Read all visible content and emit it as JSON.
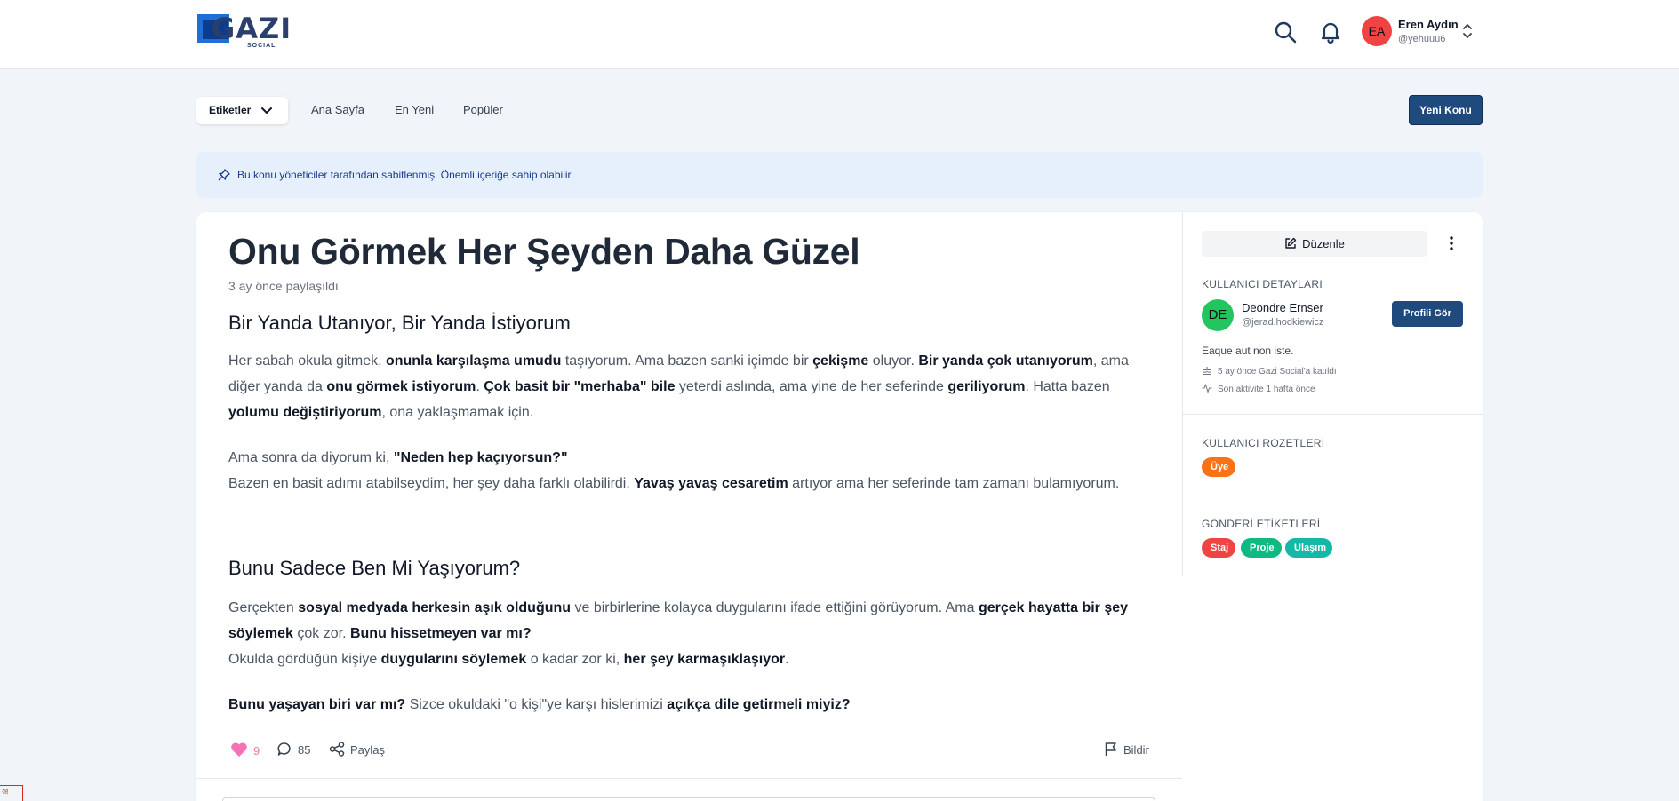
{
  "brand": {
    "logo_text": "GAZI",
    "logo_sub": "SOCIAL"
  },
  "header": {
    "icons": [
      "search-icon",
      "bell-icon"
    ],
    "user": {
      "initials": "EA",
      "name": "Eren Aydın",
      "handle": "@yehuuu6"
    }
  },
  "nav": {
    "tags_label": "Etiketler",
    "links": [
      "Ana Sayfa",
      "En Yeni",
      "Popüler"
    ],
    "new_topic": "Yeni Konu"
  },
  "pinned_notice": "Bu konu yöneticiler tarafından sabitlenmiş. Önemli içeriğe sahip olabilir.",
  "post": {
    "title": "Onu Görmek Her Şeyden Daha Güzel",
    "date": "3 ay önce paylaşıldı",
    "heading1": "Bir Yanda Utanıyor, Bir Yanda İstiyorum",
    "heading2": "Bunu Sadece Ben Mi Yaşıyorum?",
    "paragraphs": [
      [
        {
          "t": "Her sabah okula gitmek, "
        },
        {
          "t": "onunla karşılaşma umudu",
          "b": true
        },
        {
          "t": " taşıyorum. Ama bazen sanki içimde bir "
        },
        {
          "t": "çekişme",
          "b": true
        },
        {
          "t": " oluyor. "
        },
        {
          "t": "Bir yanda çok utanıyorum",
          "b": true
        },
        {
          "t": ", ama diğer yanda da "
        },
        {
          "t": "onu görmek istiyorum",
          "b": true
        },
        {
          "t": ". "
        },
        {
          "t": "Çok basit bir \"merhaba\" bile",
          "b": true
        },
        {
          "t": " yeterdi aslında, ama yine de her seferinde "
        },
        {
          "t": "geriliyorum",
          "b": true
        },
        {
          "t": ". Hatta bazen "
        },
        {
          "t": "yolumu değiştiriyorum",
          "b": true
        },
        {
          "t": ", ona yaklaşmamak için."
        }
      ],
      [
        {
          "t": "Ama sonra da diyorum ki, "
        },
        {
          "t": "\"Neden hep kaçıyorsun?\"",
          "b": true
        },
        {
          "br": true
        },
        {
          "t": "Bazen en basit adımı atabilseydim, her şey daha farklı olabilirdi. "
        },
        {
          "t": "Yavaş yavaş cesaretim",
          "b": true
        },
        {
          "t": " artıyor ama her seferinde tam zamanı bulamıyorum."
        }
      ],
      [
        {
          "t": "Gerçekten "
        },
        {
          "t": "sosyal medyada herkesin aşık olduğunu",
          "b": true
        },
        {
          "t": " ve birbirlerine kolayca duygularını ifade ettiğini görüyorum. Ama "
        },
        {
          "t": "gerçek hayatta bir şey söylemek",
          "b": true
        },
        {
          "t": " çok zor. "
        },
        {
          "t": "Bunu hissetmeyen var mı?",
          "b": true
        },
        {
          "br": true
        },
        {
          "t": "Okulda gördüğün kişiye "
        },
        {
          "t": "duygularını söylemek",
          "b": true
        },
        {
          "t": " o kadar zor ki, "
        },
        {
          "t": "her şey karmaşıklaşıyor",
          "b": true
        },
        {
          "t": "."
        }
      ],
      [
        {
          "t": "Bunu yaşayan biri var mı?",
          "b": true
        },
        {
          "t": " Sizce okuldaki \"o kişi\"ye karşı hislerimizi "
        },
        {
          "t": "açıkça dile getirmeli miyiz?",
          "b": true
        }
      ]
    ],
    "likes": "9",
    "comments": "85",
    "share_label": "Paylaş",
    "report_label": "Bildir"
  },
  "sidebar": {
    "edit_label": "Düzenle",
    "user_details_label": "KULLANICI DETAYLARI",
    "author": {
      "initials": "DE",
      "name": "Deondre Ernser",
      "handle": "@jerad.hodkiewicz"
    },
    "profile_button": "Profili Gör",
    "bio": "Eaque aut non iste.",
    "joined": "5 ay önce Gazi Social'a katıldı",
    "last_active": "Son aktivite 1 hafta önce",
    "badges_label": "KULLANICI ROZETLERİ",
    "badges": [
      {
        "label": "Üye",
        "color": "#f97316"
      }
    ],
    "tags_label": "GÖNDERİ ETİKETLERİ",
    "tags": [
      {
        "label": "Staj",
        "color": "#ef4444"
      },
      {
        "label": "Proje",
        "color": "#10b981"
      },
      {
        "label": "Ulaşım",
        "color": "#14b8a6"
      }
    ]
  },
  "corner_text": "ঞ্জ"
}
